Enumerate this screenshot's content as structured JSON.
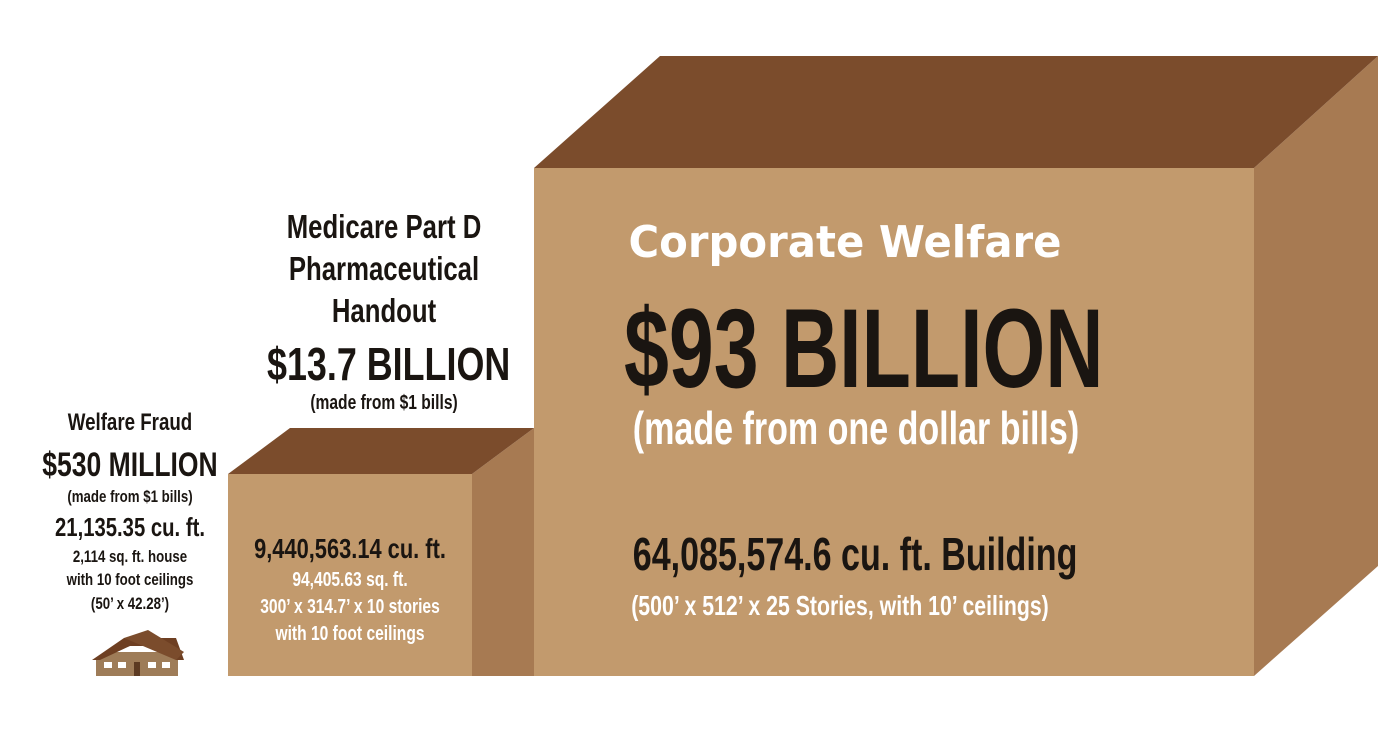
{
  "colors": {
    "front": "#c29a6d",
    "top": "#7b4c2c",
    "side": "#a77a52",
    "text_dark": "#1a1511",
    "text_light": "#ffffff"
  },
  "welfare_fraud": {
    "title": "Welfare Fraud",
    "amount": "$530 MILLION",
    "note": "(made from $1 bills)",
    "volume": "21,135.35 cu. ft.",
    "detail_1": "2,114 sq. ft. house",
    "detail_2": "with 10 foot ceilings",
    "detail_3": "(50’ x 42.28’)",
    "icon": "house-icon"
  },
  "medicare": {
    "title_1": "Medicare Part D",
    "title_2": "Pharmaceutical",
    "title_3": "Handout",
    "amount": "$13.7 BILLION",
    "note": "(made from $1 bills)",
    "volume": "9,440,563.14 cu. ft.",
    "detail_1": "94,405.63 sq. ft.",
    "detail_2": "300’ x 314.7’ x 10 stories",
    "detail_3": "with 10 foot ceilings"
  },
  "corporate": {
    "title": "Corporate Welfare",
    "amount": "$93 BILLION",
    "note": "(made from one dollar bills)",
    "volume": "64,085,574.6 cu. ft. Building",
    "detail": "(500’ x 512’ x 25 Stories, with 10’ ceilings)"
  }
}
